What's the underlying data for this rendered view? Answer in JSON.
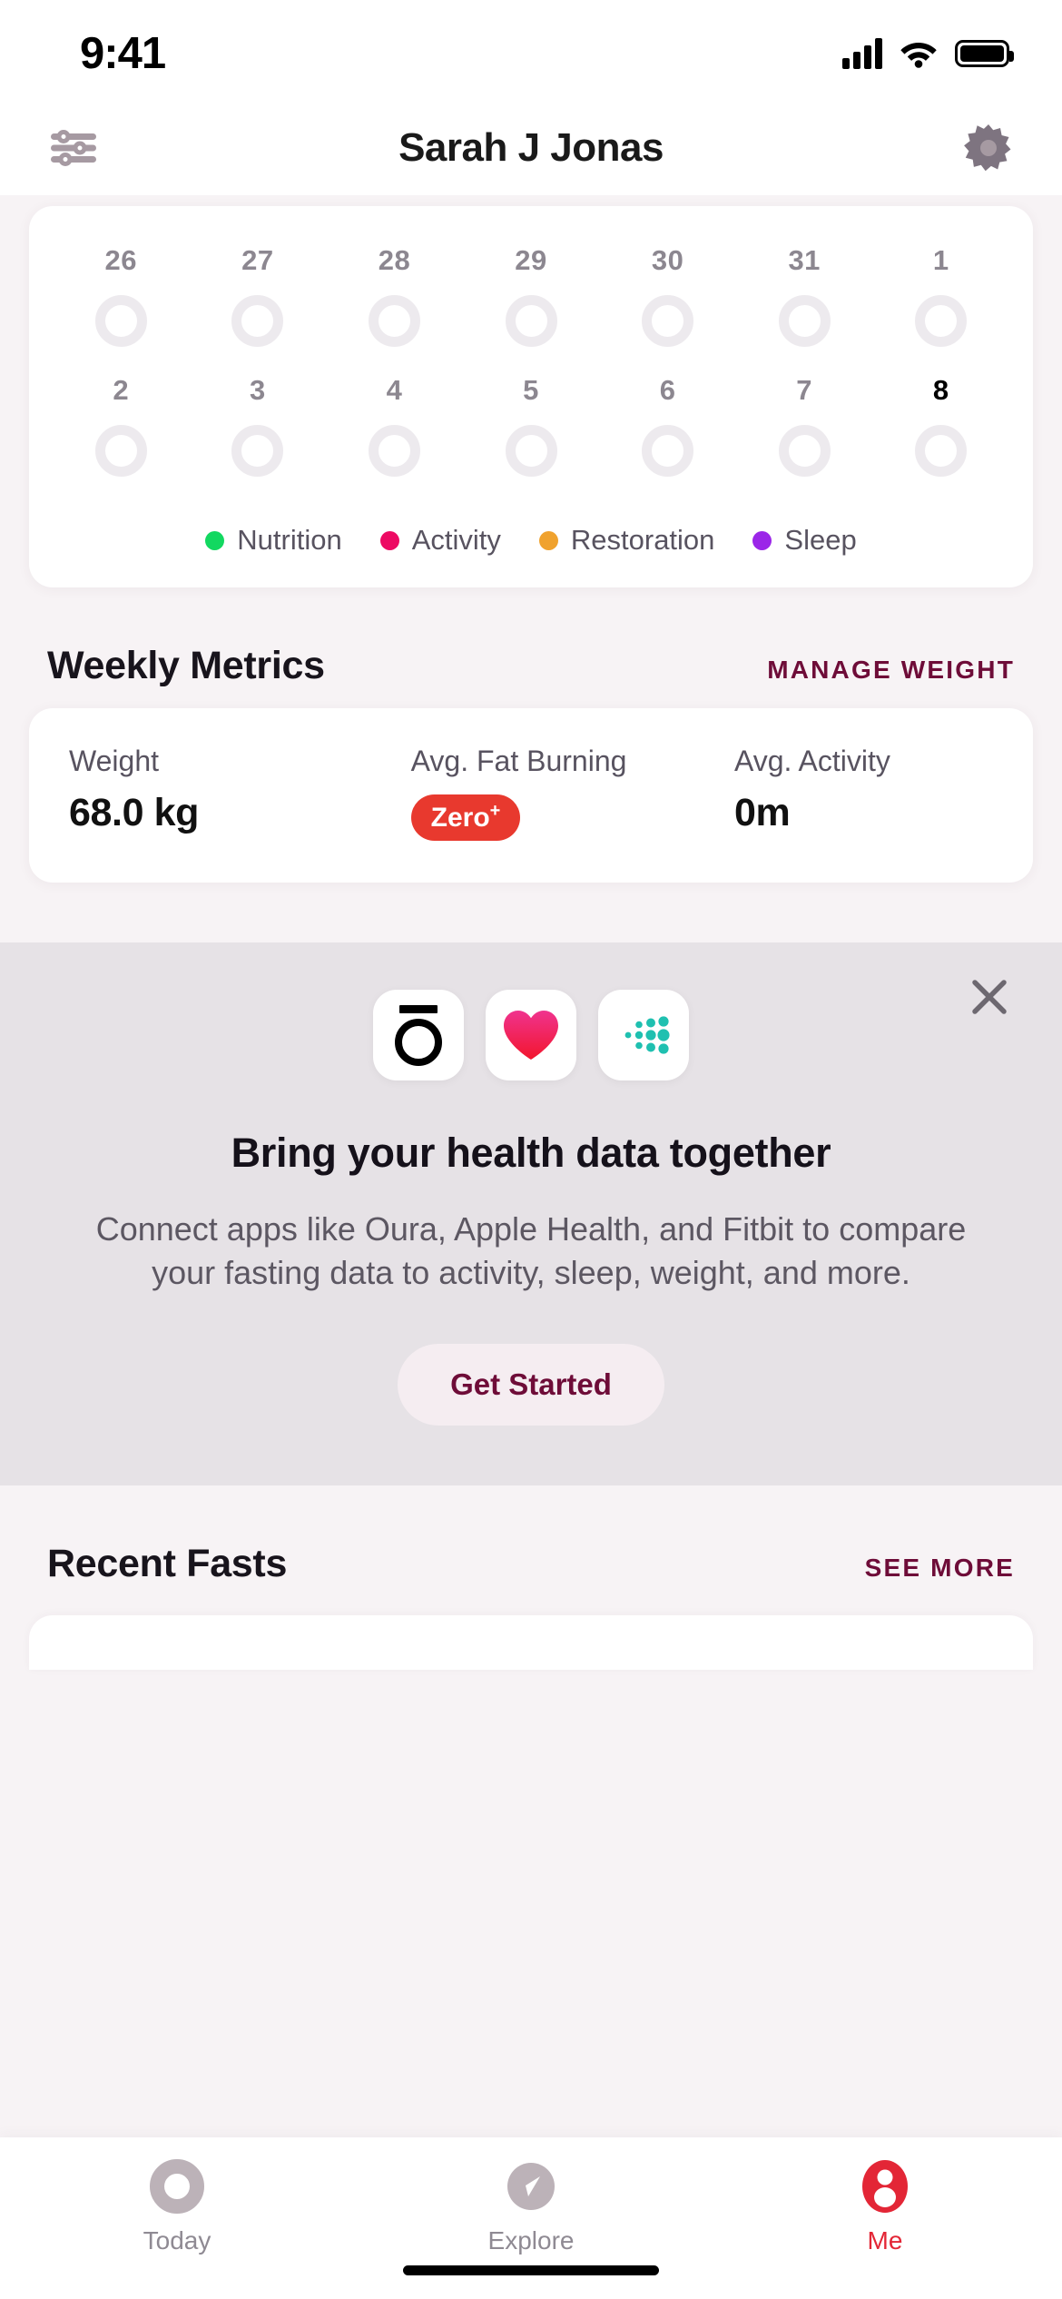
{
  "status_bar": {
    "time": "9:41",
    "signal_icon": "cellular-bars-icon",
    "wifi_icon": "wifi-icon",
    "battery_icon": "battery-full-icon"
  },
  "header": {
    "title": "Sarah J Jonas",
    "left_icon": "sliders-icon",
    "right_icon": "gear-icon"
  },
  "calendar": {
    "rows": [
      [
        {
          "day": "26",
          "today": false
        },
        {
          "day": "27",
          "today": false
        },
        {
          "day": "28",
          "today": false
        },
        {
          "day": "29",
          "today": false
        },
        {
          "day": "30",
          "today": false
        },
        {
          "day": "31",
          "today": false
        },
        {
          "day": "1",
          "today": false
        }
      ],
      [
        {
          "day": "2",
          "today": false
        },
        {
          "day": "3",
          "today": false
        },
        {
          "day": "4",
          "today": false
        },
        {
          "day": "5",
          "today": false
        },
        {
          "day": "6",
          "today": false
        },
        {
          "day": "7",
          "today": false
        },
        {
          "day": "8",
          "today": true
        }
      ]
    ],
    "legend": [
      {
        "label": "Nutrition",
        "color": "#12D860"
      },
      {
        "label": "Activity",
        "color": "#ED0A63"
      },
      {
        "label": "Restoration",
        "color": "#F0A22E"
      },
      {
        "label": "Sleep",
        "color": "#9B26E8"
      }
    ]
  },
  "weekly_metrics": {
    "title": "Weekly Metrics",
    "link_label": "MANAGE WEIGHT",
    "link_color": "#6E0C38",
    "metrics": [
      {
        "label": "Weight",
        "value": "68.0 kg",
        "type": "text"
      },
      {
        "label": "Avg. Fat Burning",
        "value": "Zero",
        "value_sup": "+",
        "type": "badge",
        "badge_color": "#E8392E"
      },
      {
        "label": "Avg. Activity",
        "value": "0m",
        "type": "text"
      }
    ]
  },
  "promo": {
    "close_icon": "close-icon",
    "apps": [
      {
        "name": "oura-icon",
        "label": "Oura"
      },
      {
        "name": "apple-health-icon",
        "label": "Apple Health"
      },
      {
        "name": "fitbit-icon",
        "label": "Fitbit"
      }
    ],
    "title": "Bring your health data together",
    "body": "Connect apps like Oura, Apple Health, and Fitbit to compare your fasting data to activity, sleep, weight, and more.",
    "button_label": "Get Started",
    "button_text_color": "#6E0C38",
    "background": "#E6E2E6"
  },
  "recent_fasts": {
    "title": "Recent Fasts",
    "link_label": "SEE MORE",
    "link_color": "#6E0C38"
  },
  "tab_bar": {
    "tabs": [
      {
        "label": "Today",
        "icon": "today-ring-icon",
        "active": false
      },
      {
        "label": "Explore",
        "icon": "compass-icon",
        "active": false
      },
      {
        "label": "Me",
        "icon": "person-icon",
        "active": true
      }
    ],
    "active_color": "#E32636",
    "inactive_color": "#BCB2B8"
  }
}
